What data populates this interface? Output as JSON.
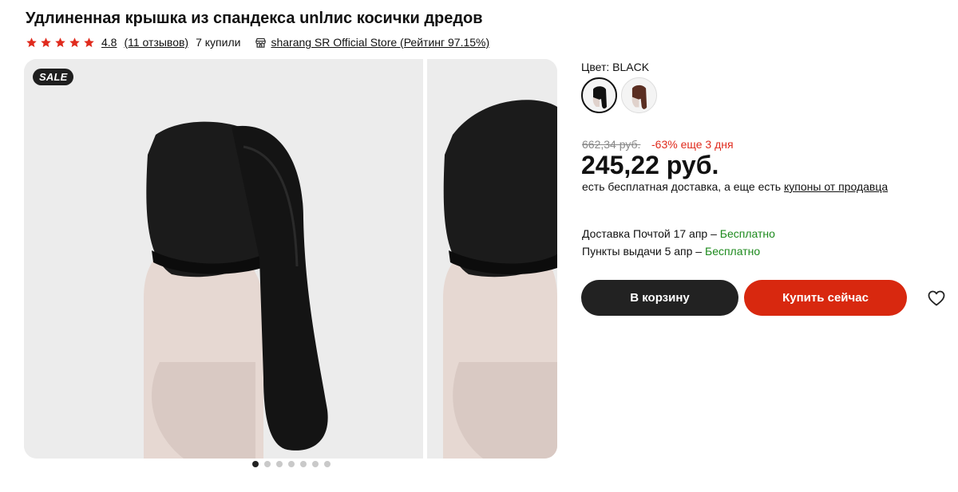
{
  "product": {
    "title": "Удлиненная крышка из спандекса unlлис косички дредов",
    "rating": "4.8",
    "reviews": "(11 отзывов)",
    "bought": "7 купили",
    "store": "sharang SR Official Store (Рейтинг 97.15%)"
  },
  "gallery": {
    "badge": "SALE",
    "slide_count": 7,
    "active_index": 0
  },
  "color": {
    "label": "Цвет: BLACK",
    "options": [
      {
        "name": "black",
        "color": "#111111",
        "selected": true
      },
      {
        "name": "brown",
        "color": "#5a2e22",
        "selected": false
      }
    ]
  },
  "pricing": {
    "old_price": "662,34 руб.",
    "discount": "-63% еще 3 дня",
    "price": "245,22 руб.",
    "delivery_note_prefix": "есть бесплатная доставка, а еще есть ",
    "coupons_link": "купоны от продавца"
  },
  "shipping": {
    "post_text": "Доставка Почтой 17 апр – ",
    "post_price": "Бесплатно",
    "pickup_text": "Пункты выдачи 5 апр – ",
    "pickup_price": "Бесплатно"
  },
  "actions": {
    "add_to_cart": "В корзину",
    "buy_now": "Купить сейчас"
  },
  "colors": {
    "accent": "#d8280f",
    "dark_button": "#222222",
    "free_green": "#1d8a1d",
    "discount_red": "#e02b1d",
    "star": "#e02b1d"
  }
}
